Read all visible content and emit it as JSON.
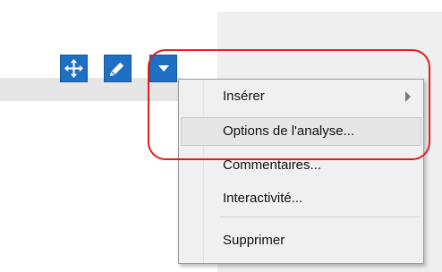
{
  "toolbar": {
    "move_icon": "move-icon",
    "edit_icon": "pencil-icon",
    "dropdown_icon": "caret-down-icon",
    "accent_color": "#1f6fc5"
  },
  "menu": {
    "items": [
      {
        "label": "Insérer",
        "has_submenu": true
      },
      {
        "label": "Options de l'analyse...",
        "highlighted": true
      },
      {
        "label": "Commentaires..."
      },
      {
        "label": "Interactivité..."
      },
      {
        "label": "Supprimer"
      }
    ]
  },
  "callout_color": "#e01e1e"
}
